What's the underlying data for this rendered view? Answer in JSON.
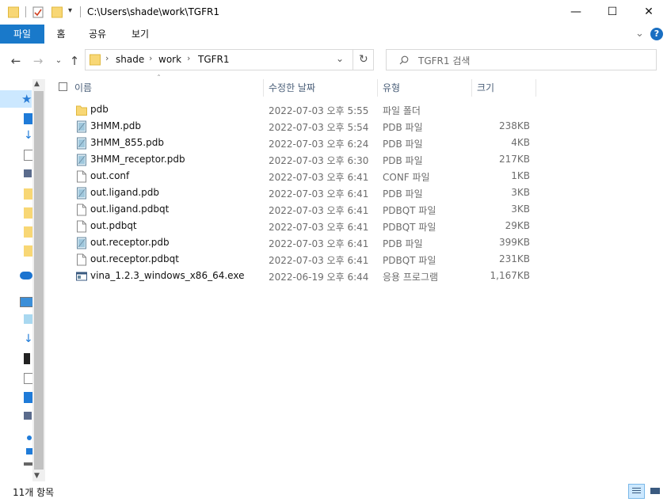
{
  "title_bar": {
    "path": "C:\\Users\\shade\\work\\TGFR1",
    "minimize_label": "—",
    "maximize_label": "☐",
    "close_label": "✕"
  },
  "ribbon": {
    "tabs": [
      "파일",
      "홈",
      "공유",
      "보기"
    ],
    "help_label": "?"
  },
  "address": {
    "crumbs": [
      "shade",
      "work",
      "TGFR1"
    ]
  },
  "search": {
    "placeholder": "TGFR1 검색"
  },
  "columns": {
    "name": "이름",
    "date": "수정한 날짜",
    "type": "유형",
    "size": "크기"
  },
  "files": [
    {
      "name": "pdb",
      "date": "2022-07-03 오후 5:55",
      "type": "파일 폴더",
      "size": "",
      "icon": "folder-icon"
    },
    {
      "name": "3HMM.pdb",
      "date": "2022-07-03 오후 5:54",
      "type": "PDB 파일",
      "size": "238KB",
      "icon": "pdb-file-icon"
    },
    {
      "name": "3HMM_855.pdb",
      "date": "2022-07-03 오후 6:24",
      "type": "PDB 파일",
      "size": "4KB",
      "icon": "pdb-file-icon"
    },
    {
      "name": "3HMM_receptor.pdb",
      "date": "2022-07-03 오후 6:30",
      "type": "PDB 파일",
      "size": "217KB",
      "icon": "pdb-file-icon"
    },
    {
      "name": "out.conf",
      "date": "2022-07-03 오후 6:41",
      "type": "CONF 파일",
      "size": "1KB",
      "icon": "blank-file-icon"
    },
    {
      "name": "out.ligand.pdb",
      "date": "2022-07-03 오후 6:41",
      "type": "PDB 파일",
      "size": "3KB",
      "icon": "pdb-file-icon"
    },
    {
      "name": "out.ligand.pdbqt",
      "date": "2022-07-03 오후 6:41",
      "type": "PDBQT 파일",
      "size": "3KB",
      "icon": "blank-file-icon"
    },
    {
      "name": "out.pdbqt",
      "date": "2022-07-03 오후 6:41",
      "type": "PDBQT 파일",
      "size": "29KB",
      "icon": "blank-file-icon"
    },
    {
      "name": "out.receptor.pdb",
      "date": "2022-07-03 오후 6:41",
      "type": "PDB 파일",
      "size": "399KB",
      "icon": "pdb-file-icon"
    },
    {
      "name": "out.receptor.pdbqt",
      "date": "2022-07-03 오후 6:41",
      "type": "PDBQT 파일",
      "size": "231KB",
      "icon": "blank-file-icon"
    },
    {
      "name": "vina_1.2.3_windows_x86_64.exe",
      "date": "2022-06-19 오후 6:44",
      "type": "응용 프로그램",
      "size": "1,167KB",
      "icon": "exe-file-icon"
    }
  ],
  "status": {
    "item_count": "11개 항목"
  },
  "colors": {
    "accent": "#1979ca",
    "folder": "#f8d775",
    "header_text": "#4c607a",
    "help": "#1a6fc2"
  }
}
